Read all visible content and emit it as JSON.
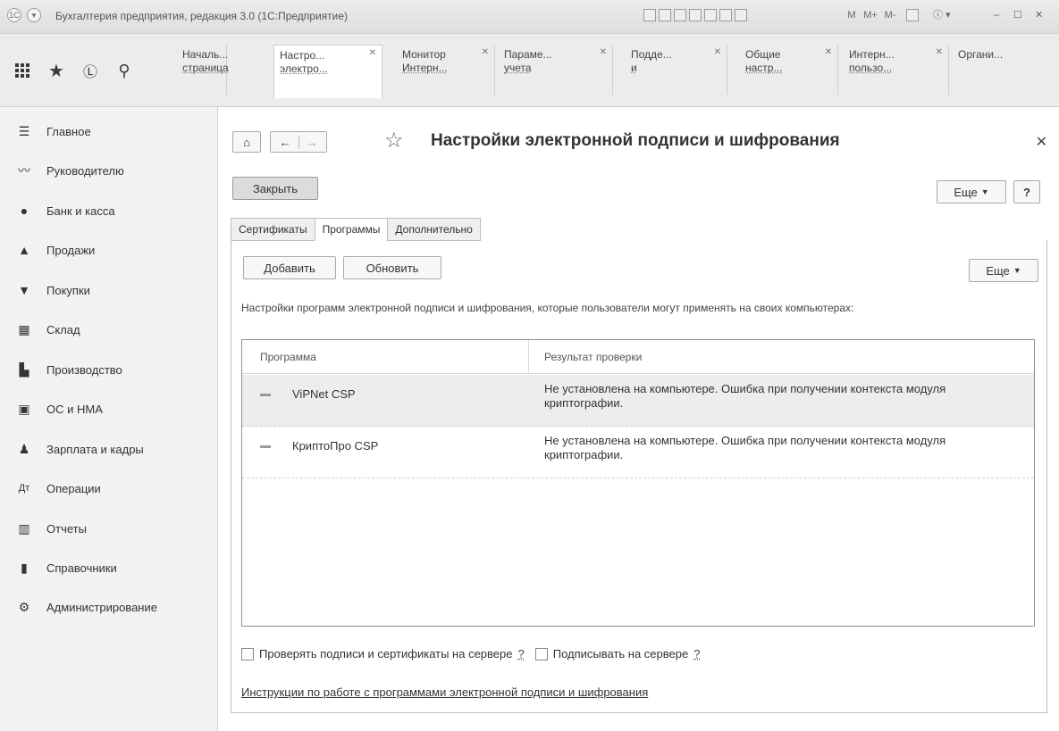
{
  "window": {
    "title": "Бухгалтерия предприятия, редакция 3.0 (1С:Предприятие)",
    "toolbar_right": [
      "M",
      "M+",
      "M-"
    ]
  },
  "tabs": [
    {
      "line1": "Началь...",
      "line2": "страница",
      "active": false
    },
    {
      "line1": "Настро...",
      "line2": "электро...",
      "active": true
    },
    {
      "line1": "Монитор",
      "line2": "Интерн...",
      "active": false
    },
    {
      "line1": "Параме...",
      "line2": "учета",
      "active": false
    },
    {
      "line1": "Подде...",
      "line2": "и",
      "active": false
    },
    {
      "line1": "Общие",
      "line2": "настр...",
      "active": false
    },
    {
      "line1": "Интерн...",
      "line2": "пользо...",
      "active": false
    },
    {
      "line1": "Органи...",
      "line2": "",
      "active": false
    }
  ],
  "sidebar": {
    "items": [
      {
        "label": "Главное",
        "icon": "menu-icon"
      },
      {
        "label": "Руководителю",
        "icon": "trend-icon"
      },
      {
        "label": "Банк и касса",
        "icon": "coin-icon"
      },
      {
        "label": "Продажи",
        "icon": "bag-icon"
      },
      {
        "label": "Покупки",
        "icon": "cart-icon"
      },
      {
        "label": "Склад",
        "icon": "warehouse-icon"
      },
      {
        "label": "Производство",
        "icon": "factory-icon"
      },
      {
        "label": "ОС и НМА",
        "icon": "truck-icon"
      },
      {
        "label": "Зарплата и кадры",
        "icon": "person-icon"
      },
      {
        "label": "Операции",
        "icon": "operations-icon"
      },
      {
        "label": "Отчеты",
        "icon": "chart-icon"
      },
      {
        "label": "Справочники",
        "icon": "book-icon"
      },
      {
        "label": "Администрирование",
        "icon": "gear-icon"
      }
    ]
  },
  "page": {
    "title": "Настройки электронной подписи и шифрования",
    "close_button": "Закрыть",
    "more_button": "Еще",
    "help_button": "?",
    "tabs": [
      "Сертификаты",
      "Программы",
      "Дополнительно"
    ],
    "active_tab": "Программы",
    "add_button": "Добавить",
    "refresh_button": "Обновить",
    "more_button_2": "Еще",
    "description": "Настройки программ электронной подписи и шифрования, которые пользователи могут применять на своих компьютерах:",
    "table": {
      "columns": [
        "Программа",
        "Результат проверки"
      ],
      "rows": [
        {
          "program": "ViPNet CSP",
          "result": "Не установлена на компьютере. Ошибка при получении контекста модуля криптографии.",
          "selected": true
        },
        {
          "program": "КриптоПро CSP",
          "result": "Не установлена на компьютере. Ошибка при получении контекста модуля криптографии.",
          "selected": false
        }
      ]
    },
    "check_server_label": "Проверять подписи и сертификаты на сервере",
    "sign_server_label": "Подписывать на сервере",
    "help_mark": "?",
    "instructions_link": "Инструкции по работе с программами электронной подписи и шифрования"
  }
}
